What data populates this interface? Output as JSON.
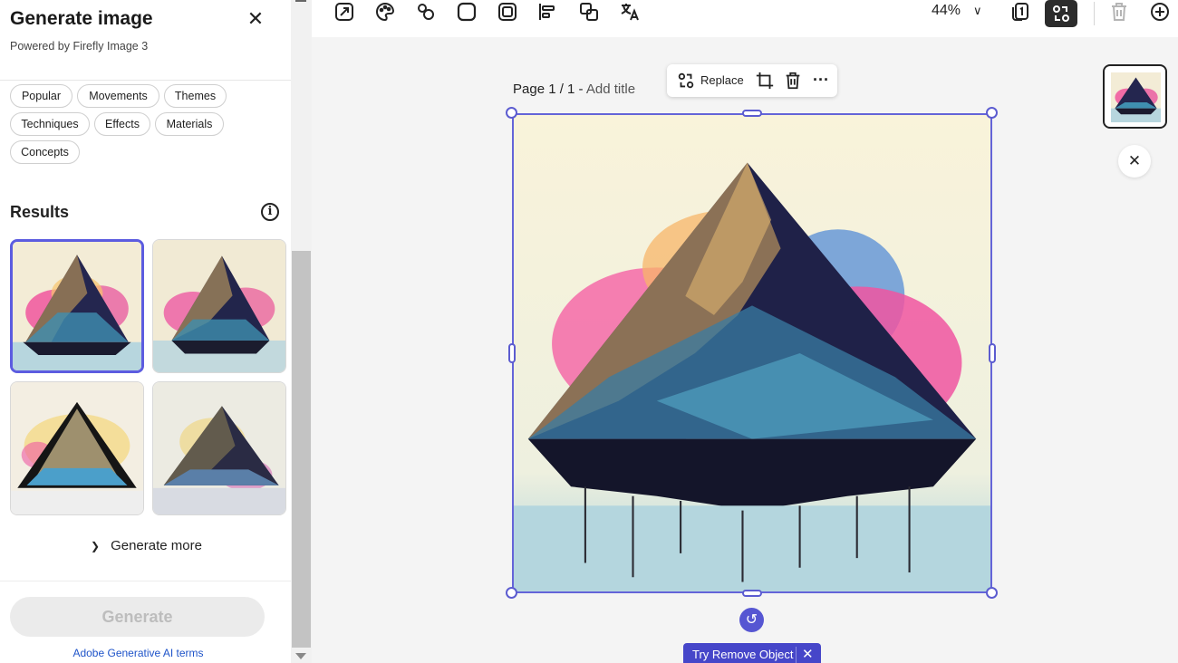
{
  "panel": {
    "title": "Generate image",
    "subtitle": "Powered by Firefly Image 3",
    "close_glyph": "✕",
    "chips": [
      "Popular",
      "Movements",
      "Themes",
      "Techniques",
      "Effects",
      "Materials",
      "Concepts"
    ],
    "results_title": "Results",
    "info_glyph": "i",
    "generate_more": "Generate more",
    "generate_button": "Generate",
    "terms_link": "Adobe Generative AI terms"
  },
  "toolbar": {
    "zoom": "44%",
    "icons": [
      "resize-icon",
      "palette-icon",
      "effects-icon",
      "shape-icon",
      "frame-icon",
      "align-icon",
      "arrange-icon",
      "translate-icon",
      "chevron-down-icon",
      "pages-icon",
      "replace-active-icon",
      "delete-icon",
      "add-icon"
    ]
  },
  "canvas": {
    "page_label": "Page 1 / 1 - ",
    "add_title": "Add title",
    "replace_label": "Replace",
    "more_glyph": "···",
    "rotate_glyph": "↺",
    "try_remove": "Try Remove Object",
    "try_remove_close": "✕",
    "panel_close_glyph": "✕"
  },
  "colors": {
    "accent": "#5c5ce0",
    "try_remove_bg": "#4646c9"
  }
}
